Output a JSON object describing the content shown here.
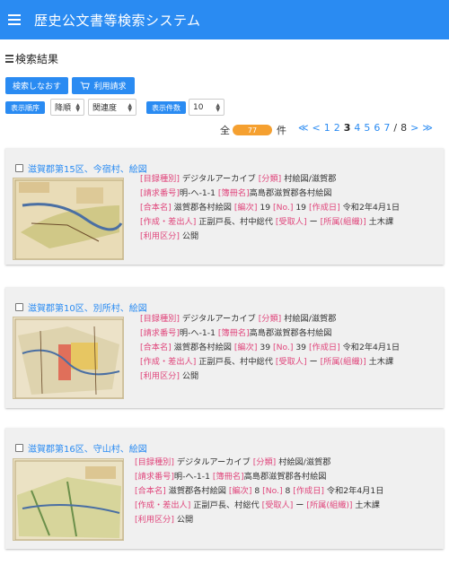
{
  "header": {
    "title": "歴史公文書等検索システム"
  },
  "results_heading": "検索結果",
  "toolbar": {
    "research_label": "検索しなおす",
    "request_label": "利用請求"
  },
  "sort": {
    "order_label": "表示順序",
    "order_value": "降順",
    "key_value": "関連度",
    "count_label": "表示件数",
    "count_value": "10"
  },
  "summary": {
    "prefix": "全",
    "total": "77",
    "suffix": "件"
  },
  "pager": {
    "first": "≪",
    "prev": "<",
    "pages": [
      "1",
      "2",
      "3",
      "4",
      "5",
      "6",
      "7"
    ],
    "current": "3",
    "separator": "/",
    "last_page": "8",
    "next": ">",
    "last": "≫"
  },
  "labels": {
    "catalog_type": "[目録種別]",
    "category": "[分類]",
    "request_no": "[請求番号]",
    "volume_name": "[簿冊名]",
    "combined_name": "[合本名]",
    "edition": "[編次]",
    "no": "[No.]",
    "created_date": "[作成日]",
    "creator": "[作成・差出人]",
    "recipient": "[受取人]",
    "affiliation": "[所属(組織)]",
    "usage": "[利用区分]"
  },
  "records": [
    {
      "title": "滋賀郡第15区、今宿村、絵図",
      "catalog_type": "デジタルアーカイブ",
      "category": "村絵図/滋賀郡",
      "request_no": "明-へ-1-1",
      "volume_name": "高島郡滋賀郡各村絵図",
      "combined_name": "滋賀郡各村絵図",
      "edition": "19",
      "no": "19",
      "created_date": "令和2年4月1日",
      "creator": "正副戸長、村中総代",
      "recipient": "ー",
      "affiliation": "土木課",
      "usage": "公開",
      "thumb_icon": "map-thumbnail-icon"
    },
    {
      "title": "滋賀郡第10区、別所村、絵図",
      "catalog_type": "デジタルアーカイブ",
      "category": "村絵図/滋賀郡",
      "request_no": "明-へ-1-1",
      "volume_name": "高島郡滋賀郡各村絵図",
      "combined_name": "滋賀郡各村絵図",
      "edition": "39",
      "no": "39",
      "created_date": "令和2年4月1日",
      "creator": "正副戸長、村中総代",
      "recipient": "ー",
      "affiliation": "土木課",
      "usage": "公開",
      "thumb_icon": "map-thumbnail-icon"
    },
    {
      "title": "滋賀郡第16区、守山村、絵図",
      "catalog_type": "デジタルアーカイブ",
      "category": "村絵図/滋賀郡",
      "request_no": "明-へ-1-1",
      "volume_name": "高島郡滋賀郡各村絵図",
      "combined_name": "滋賀郡各村絵図",
      "edition": "8",
      "no": "8",
      "created_date": "令和2年4月1日",
      "creator": "正副戸長、村総代",
      "recipient": "ー",
      "affiliation": "土木課",
      "usage": "公開",
      "thumb_icon": "map-thumbnail-icon"
    }
  ],
  "colors": {
    "primary": "#2a8bf2",
    "label": "#e0457b",
    "badge": "#f5a030",
    "card_bg": "#f0f0f0"
  }
}
